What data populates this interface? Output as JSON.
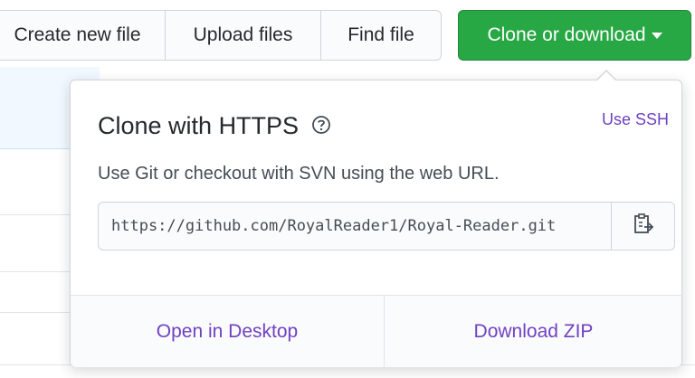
{
  "toolbar": {
    "create_label": "Create new file",
    "upload_label": "Upload files",
    "find_label": "Find file",
    "clone_label": "Clone or download"
  },
  "popover": {
    "title": "Clone with HTTPS",
    "use_ssh": "Use SSH",
    "description": "Use Git or checkout with SVN using the web URL.",
    "url": "https://github.com/RoyalReader1/Royal-Reader.git",
    "open_desktop": "Open in Desktop",
    "download_zip": "Download ZIP"
  },
  "colors": {
    "accent_green": "#28a745",
    "link_purple": "#6f42c1"
  },
  "icons": {
    "help": "question-circle-icon",
    "copy": "clipboard-icon",
    "caret": "caret-down-icon"
  }
}
